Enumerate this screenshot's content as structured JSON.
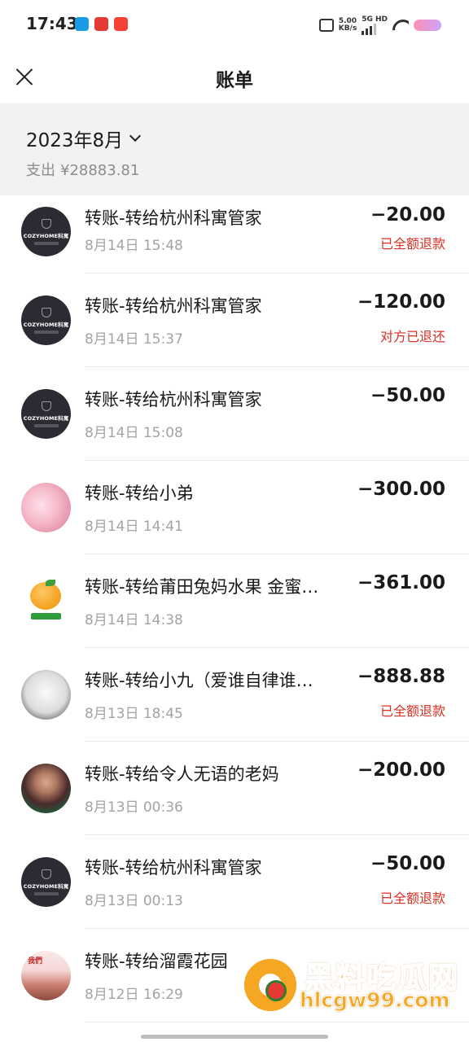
{
  "status_bar": {
    "time": "17:43",
    "network_speed": "5.00",
    "network_unit": "KB/s",
    "network_type": "5G HD",
    "icons": [
      "vibrate-icon",
      "signal-icon",
      "wifi-icon",
      "battery-icon"
    ]
  },
  "nav": {
    "title": "账单",
    "close_icon": "close-icon"
  },
  "summary": {
    "month": "2023年8月",
    "spend_label": "支出",
    "spend_amount": "¥28883.81"
  },
  "transactions": [
    {
      "title": "转账-转给杭州科寓管家",
      "time": "8月14日 15:48",
      "amount": "−20.00",
      "status": "已全额退款",
      "avatar": "cozyhome-logo-avatar"
    },
    {
      "title": "转账-转给杭州科寓管家",
      "time": "8月14日 15:37",
      "amount": "−120.00",
      "status": "对方已退还",
      "avatar": "cozyhome-logo-avatar"
    },
    {
      "title": "转账-转给杭州科寓管家",
      "time": "8月14日 15:08",
      "amount": "−50.00",
      "status": "",
      "avatar": "cozyhome-logo-avatar"
    },
    {
      "title": "转账-转给小弟",
      "time": "8月14日 14:41",
      "amount": "−300.00",
      "status": "",
      "avatar": "anime-girl-avatar"
    },
    {
      "title": "转账-转给莆田兔妈水果 金蜜…",
      "time": "8月14日 14:38",
      "amount": "−361.00",
      "status": "",
      "avatar": "orange-fruit-avatar"
    },
    {
      "title": "转账-转给小九（爱谁自律谁…",
      "time": "8月13日 18:45",
      "amount": "−888.88",
      "status": "已全额退款",
      "avatar": "sketch-girl-avatar"
    },
    {
      "title": "转账-转给令人无语的老妈",
      "time": "8月13日 00:36",
      "amount": "−200.00",
      "status": "",
      "avatar": "woman-photo-avatar"
    },
    {
      "title": "转账-转给杭州科寓管家",
      "time": "8月13日 00:13",
      "amount": "−50.00",
      "status": "已全额退款",
      "avatar": "cozyhome-logo-avatar"
    },
    {
      "title": "转账-转给溜霞花园",
      "time": "8月12日 16:29",
      "amount": "",
      "status": "",
      "avatar": "couple-photo-avatar"
    }
  ],
  "cozy_brand": "COZYHOME科寓",
  "avatar_caption": "我們",
  "watermark": {
    "title": "黑料吃瓜网",
    "url": "hlcgw99.com"
  },
  "colors": {
    "refund_status": "#d93025",
    "summary_bg": "#f2f2f2",
    "watermark": "#f5a623"
  }
}
